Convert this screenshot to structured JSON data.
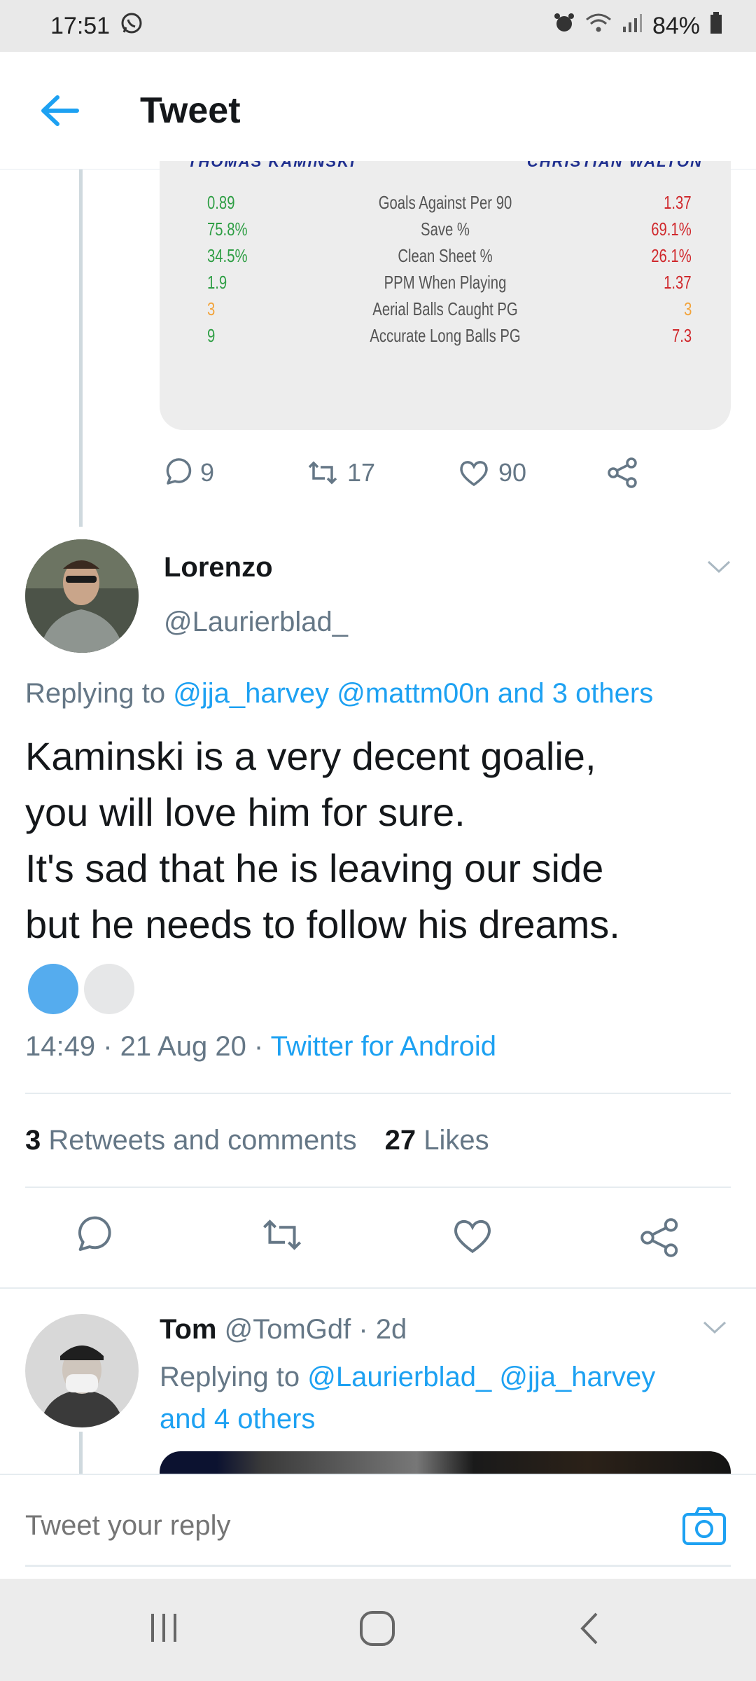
{
  "status_bar": {
    "time": "17:51",
    "battery": "84%"
  },
  "header": {
    "title": "Tweet"
  },
  "stats_card": {
    "left_player": "THOMAS KAMINSKI",
    "right_player": "CHRISTIAN WALTON",
    "rows": [
      {
        "left": "0.89",
        "label": "Goals Against Per 90",
        "right": "1.37",
        "left_color": "#2e9e44",
        "right_color": "#d0282c"
      },
      {
        "left": "75.8%",
        "label": "Save %",
        "right": "69.1%",
        "left_color": "#2e9e44",
        "right_color": "#d0282c"
      },
      {
        "left": "34.5%",
        "label": "Clean Sheet %",
        "right": "26.1%",
        "left_color": "#2e9e44",
        "right_color": "#d0282c"
      },
      {
        "left": "1.9",
        "label": "PPM When Playing",
        "right": "1.37",
        "left_color": "#2e9e44",
        "right_color": "#d0282c"
      },
      {
        "left": "3",
        "label": "Aerial Balls Caught PG",
        "right": "3",
        "left_color": "#f2a33a",
        "right_color": "#f2a33a"
      },
      {
        "left": "9",
        "label": "Accurate Long Balls PG",
        "right": "7.3",
        "left_color": "#2e9e44",
        "right_color": "#d0282c"
      }
    ]
  },
  "parent_actions": {
    "replies": "9",
    "retweets": "17",
    "likes": "90"
  },
  "main_tweet": {
    "name": "Lorenzo",
    "handle": "@Laurierblad_",
    "replying_prefix": "Replying to",
    "replying_handles": "@jja_harvey @mattm00n and 3 others",
    "text_lines": [
      "Kaminski is a very decent goalie,",
      "you will love him for sure.",
      "It's sad that he is leaving our side",
      "but he needs to follow his dreams."
    ],
    "time": "14:49 · 21 Aug 20 ·",
    "source": "Twitter for Android",
    "retweets_count": "3",
    "retweets_label": "Retweets and comments",
    "likes_count": "27",
    "likes_label": "Likes"
  },
  "reply_tweet": {
    "name": "Tom",
    "handle_time": "@TomGdf · 2d",
    "replying_prefix": "Replying to",
    "replying_handles_line1": "@Laurierblad_ @jja_harvey",
    "replying_handles_line2": "and 4 others"
  },
  "composer": {
    "placeholder": "Tweet your reply"
  },
  "colors": {
    "accent": "#1da1f2",
    "muted": "#657786"
  }
}
